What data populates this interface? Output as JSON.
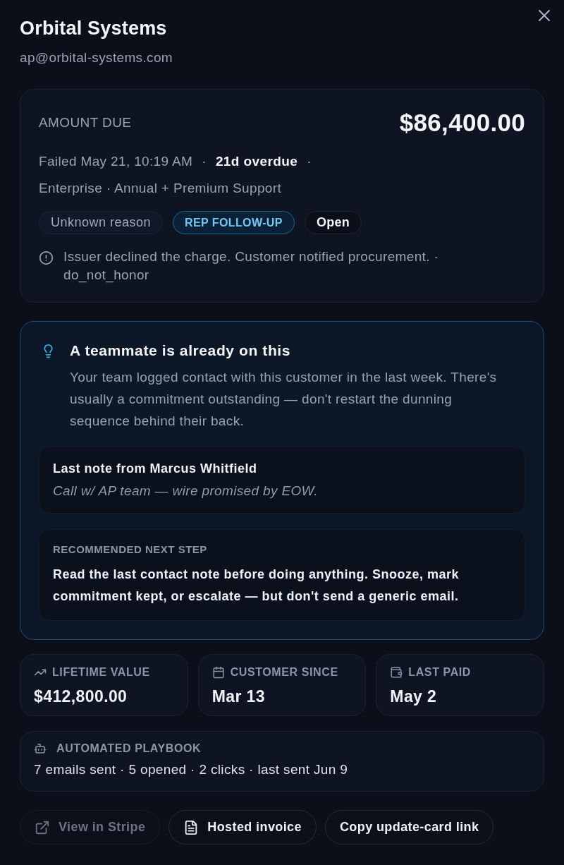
{
  "drawer": {
    "title": "Orbital Systems",
    "email": "ap@orbital-systems.com"
  },
  "amount_card": {
    "label": "AMOUNT DUE",
    "amount": "$86,400.00",
    "meta": [
      {
        "kind": "text",
        "text": "Failed May 21, 10:19 AM"
      },
      {
        "kind": "dot",
        "text": "·"
      },
      {
        "kind": "strong",
        "text": "21d overdue"
      },
      {
        "kind": "dot",
        "text": "·"
      }
    ],
    "plan": "Enterprise · Annual + Premium Support",
    "badges": [
      {
        "kind": "reason",
        "text": "Unknown reason"
      },
      {
        "kind": "tag",
        "text": "REP FOLLOW-UP"
      },
      {
        "kind": "status",
        "text": "Open"
      }
    ],
    "decline": {
      "message": "Issuer declined the charge. Customer notified procurement. ·",
      "code": "do_not_honor"
    }
  },
  "alert": {
    "title": "A teammate is already on this",
    "body": "Your team logged contact with this customer in the last week. There's usually a commitment outstanding — don't restart the dunning sequence behind their back.",
    "last_note": {
      "heading": "Last note from Marcus Whitfield",
      "note": "Call w/ AP team — wire promised by EOW."
    },
    "next_step": {
      "label": "RECOMMENDED NEXT STEP",
      "text": "Read the last contact note before doing anything. Snooze, mark commitment kept, or escalate — but don't send a generic email."
    }
  },
  "stats": [
    {
      "kind": "trend",
      "label": "LIFETIME VALUE",
      "value": "$412,800.00"
    },
    {
      "kind": "calendar",
      "label": "CUSTOMER SINCE",
      "value": "Mar 13"
    },
    {
      "kind": "wallet",
      "label": "LAST PAID",
      "value": "May 2"
    }
  ],
  "playbook": {
    "label": "AUTOMATED PLAYBOOK",
    "summary": "7 emails sent · 5 opened · 2 clicks · last sent Jun 9"
  },
  "actions": [
    {
      "kind": "external",
      "label": "View in Stripe",
      "disabled": true
    },
    {
      "kind": "file",
      "label": "Hosted invoice",
      "disabled": false
    },
    {
      "kind": "copy",
      "label": "Copy update-card link",
      "disabled": false
    }
  ]
}
